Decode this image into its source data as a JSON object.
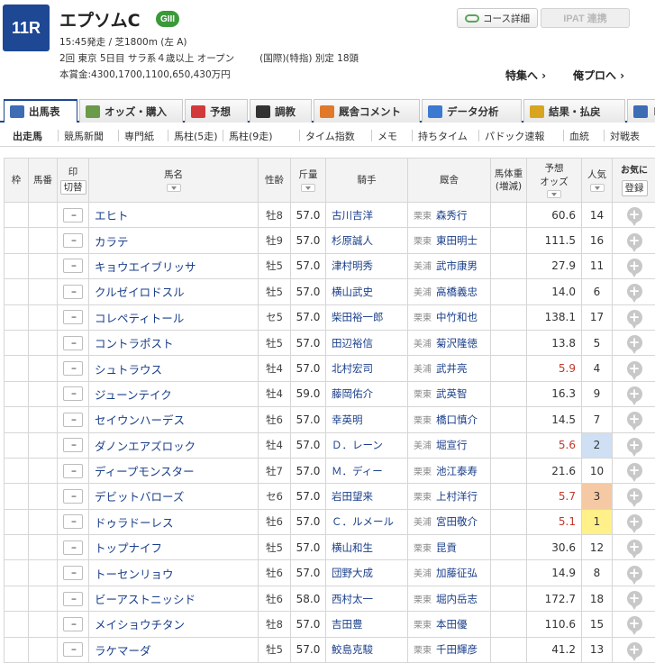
{
  "race": {
    "number": "11R",
    "name": "エプソムC",
    "grade": "GIII",
    "line1": "15:45発走 / 芝1800m (左 A)",
    "line2_left": "2回 東京 5日目 サラ系４歳以上 オープン",
    "line2_right": "(国際)(特指) 別定 18頭",
    "line3": "本賞金:4300,1700,1100,650,430万円"
  },
  "buttons": {
    "course": "コース詳細",
    "ipat": "IPAT 連携"
  },
  "links": {
    "toku": "特集へ ›",
    "ore": "俺プロへ ›"
  },
  "tabs": [
    {
      "label": "出馬表",
      "icon": "table-icon",
      "color": "#3c6db5"
    },
    {
      "label": "オッズ・購入",
      "icon": "odds-icon",
      "color": "#6a9a4a"
    },
    {
      "label": "予想",
      "icon": "target-icon",
      "color": "#d23a3a"
    },
    {
      "label": "調教",
      "icon": "stopwatch-icon",
      "color": "#333333"
    },
    {
      "label": "厩舎コメント",
      "icon": "stable-icon",
      "color": "#e07a2a"
    },
    {
      "label": "データ分析",
      "icon": "bar-chart-icon",
      "color": "#3a7ad0"
    },
    {
      "label": "結果・払戻",
      "icon": "coins-icon",
      "color": "#d9a520"
    },
    {
      "label": "レ",
      "icon": "replay-icon",
      "color": "#3c6db5"
    }
  ],
  "subtabs": [
    "出走馬",
    "競馬新聞",
    "専門紙",
    "馬柱(5走)",
    "馬柱(9走)",
    "タイム指数",
    "メモ",
    "持ちタイム",
    "パドック速報",
    "血統",
    "対戦表"
  ],
  "table": {
    "headers": {
      "waku": "枠",
      "umaban": "馬番",
      "mark": "印",
      "kiri": "切替",
      "name": "馬名",
      "sex": "性齢",
      "weight": "斤量",
      "jockey": "騎手",
      "stable": "厩舎",
      "bodyweight_1": "馬体重",
      "bodyweight_2": "(増減)",
      "odds_1": "予想",
      "odds_2": "オッズ",
      "pop": "人気",
      "fav": "お気に",
      "register": "登録"
    },
    "mark_default": "--",
    "rows": [
      {
        "name": "エヒト",
        "sex": "牡8",
        "weight": "57.0",
        "jockey": "古川吉洋",
        "region": "栗東",
        "trainer": "森秀行",
        "odds": "60.6",
        "pop": "14"
      },
      {
        "name": "カラテ",
        "sex": "牡9",
        "weight": "57.0",
        "jockey": "杉原誠人",
        "region": "栗東",
        "trainer": "東田明士",
        "odds": "111.5",
        "pop": "16"
      },
      {
        "name": "キョウエイブリッサ",
        "sex": "牡5",
        "weight": "57.0",
        "jockey": "津村明秀",
        "region": "美浦",
        "trainer": "武市康男",
        "odds": "27.9",
        "pop": "11"
      },
      {
        "name": "クルゼイロドスル",
        "sex": "牡5",
        "weight": "57.0",
        "jockey": "横山武史",
        "region": "美浦",
        "trainer": "高橋義忠",
        "odds": "14.0",
        "pop": "6"
      },
      {
        "name": "コレペティトール",
        "sex": "セ5",
        "weight": "57.0",
        "jockey": "柴田裕一郎",
        "region": "栗東",
        "trainer": "中竹和也",
        "odds": "138.1",
        "pop": "17"
      },
      {
        "name": "コントラポスト",
        "sex": "牡5",
        "weight": "57.0",
        "jockey": "田辺裕信",
        "region": "美浦",
        "trainer": "菊沢隆徳",
        "odds": "13.8",
        "pop": "5"
      },
      {
        "name": "シュトラウス",
        "sex": "牡4",
        "weight": "57.0",
        "jockey": "北村宏司",
        "region": "美浦",
        "trainer": "武井亮",
        "odds": "5.9",
        "pop": "4"
      },
      {
        "name": "ジューンテイク",
        "sex": "牡4",
        "weight": "59.0",
        "jockey": "藤岡佑介",
        "region": "栗東",
        "trainer": "武英智",
        "odds": "16.3",
        "pop": "9"
      },
      {
        "name": "セイウンハーデス",
        "sex": "牡6",
        "weight": "57.0",
        "jockey": "幸英明",
        "region": "栗東",
        "trainer": "橋口慎介",
        "odds": "14.5",
        "pop": "7"
      },
      {
        "name": "ダノンエアズロック",
        "sex": "牡4",
        "weight": "57.0",
        "jockey": "Ｄ．レーン",
        "region": "美浦",
        "trainer": "堀宣行",
        "odds": "5.6",
        "pop": "2"
      },
      {
        "name": "ディープモンスター",
        "sex": "牡7",
        "weight": "57.0",
        "jockey": "Ｍ．ディー",
        "region": "栗東",
        "trainer": "池江泰寿",
        "odds": "21.6",
        "pop": "10"
      },
      {
        "name": "デビットバローズ",
        "sex": "セ6",
        "weight": "57.0",
        "jockey": "岩田望来",
        "region": "栗東",
        "trainer": "上村洋行",
        "odds": "5.7",
        "pop": "3"
      },
      {
        "name": "ドゥラドーレス",
        "sex": "牡6",
        "weight": "57.0",
        "jockey": "Ｃ．ルメール",
        "region": "美浦",
        "trainer": "宮田敬介",
        "odds": "5.1",
        "pop": "1"
      },
      {
        "name": "トップナイフ",
        "sex": "牡5",
        "weight": "57.0",
        "jockey": "横山和生",
        "region": "栗東",
        "trainer": "昆貢",
        "odds": "30.6",
        "pop": "12"
      },
      {
        "name": "トーセンリョウ",
        "sex": "牡6",
        "weight": "57.0",
        "jockey": "団野大成",
        "region": "美浦",
        "trainer": "加藤征弘",
        "odds": "14.9",
        "pop": "8"
      },
      {
        "name": "ビーアストニッシド",
        "sex": "牡6",
        "weight": "58.0",
        "jockey": "西村太一",
        "region": "栗東",
        "trainer": "堀内岳志",
        "odds": "172.7",
        "pop": "18"
      },
      {
        "name": "メイショウチタン",
        "sex": "牡8",
        "weight": "57.0",
        "jockey": "吉田豊",
        "region": "栗東",
        "trainer": "本田優",
        "odds": "110.6",
        "pop": "15"
      },
      {
        "name": "ラケマーダ",
        "sex": "牡5",
        "weight": "57.0",
        "jockey": "鮫島克駿",
        "region": "栗東",
        "trainer": "千田輝彦",
        "odds": "41.2",
        "pop": "13"
      }
    ],
    "hot_odds_color": "#c0392b",
    "pop_colors": {
      "1": "#fff08a",
      "2": "#cfe0f5",
      "3": "#f5c9a3"
    }
  }
}
